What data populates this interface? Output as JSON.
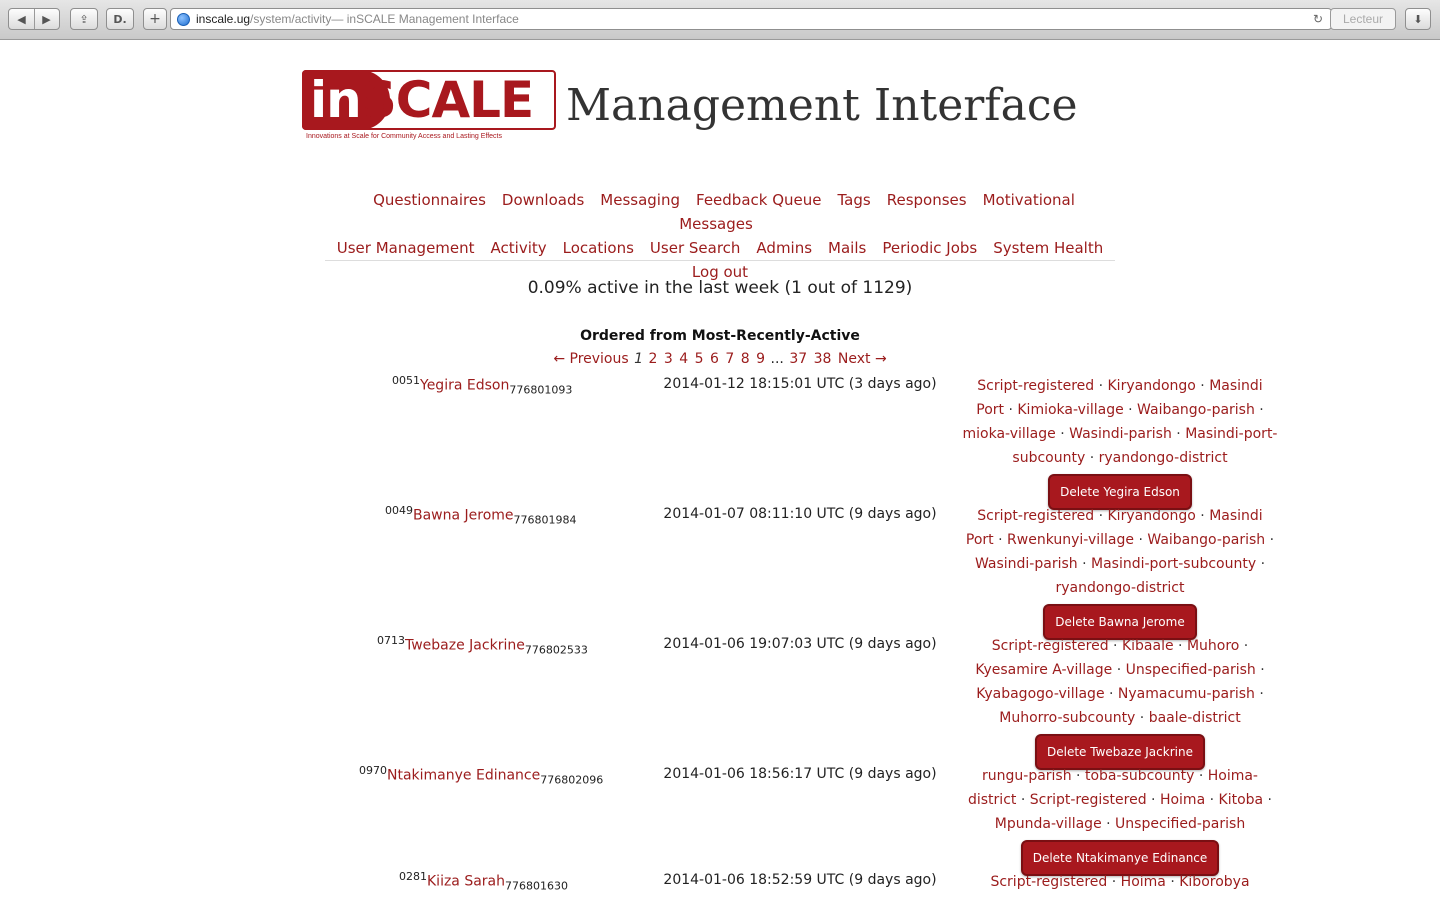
{
  "browser": {
    "url_host": "inscale.ug",
    "url_path": "/system/activity",
    "window_title": " — inSCALE Management Interface",
    "reader_label": "Lecteur"
  },
  "header": {
    "logo_in": "in",
    "logo_scale": "SCALE",
    "logo_tagline": "Innovations at Scale for Community Access and Lasting Effects",
    "title": "Management Interface"
  },
  "nav": {
    "row1": [
      "Questionnaires",
      "Downloads",
      "Messaging",
      "Feedback Queue",
      "Tags",
      "Responses",
      "Motivational Messages"
    ],
    "row2": [
      "User Management",
      "Activity",
      "Locations",
      "User Search",
      "Admins",
      "Mails",
      "Periodic Jobs",
      "System Health"
    ],
    "row3": [
      "Log out"
    ]
  },
  "summary": "0.09% active in the last week (1 out of 1129)",
  "ordered_label": "Ordered from Most-Recently-Active",
  "pager": {
    "previous": "← Previous",
    "current": "1",
    "pages": [
      "2",
      "3",
      "4",
      "5",
      "6",
      "7",
      "8",
      "9"
    ],
    "ellipsis": "...",
    "last_pages": [
      "37",
      "38"
    ],
    "next": "Next →"
  },
  "users": [
    {
      "id": "0051",
      "name": "Yegira Edson",
      "phone": "776801093",
      "date": "2014-01-12 18:15:01 UTC (3 days ago)",
      "tags": [
        "Script-registered",
        "Kiryandongo",
        "Masindi Port",
        "Kimioka-village",
        "Waibango-parish",
        "mioka-village",
        "Wasindi-parish",
        "Masindi-port-subcounty",
        "ryandongo-district"
      ],
      "delete_label": "Delete Yegira Edson"
    },
    {
      "id": "0049",
      "name": "Bawna Jerome",
      "phone": "776801984",
      "date": "2014-01-07 08:11:10 UTC (9 days ago)",
      "tags": [
        "Script-registered",
        "Kiryandongo",
        "Masindi Port",
        "Rwenkunyi-village",
        "Waibango-parish",
        "Wasindi-parish",
        "Masindi-port-subcounty",
        "ryandongo-district"
      ],
      "delete_label": "Delete Bawna Jerome"
    },
    {
      "id": "0713",
      "name": "Twebaze Jackrine",
      "phone": "776802533",
      "date": "2014-01-06 19:07:03 UTC (9 days ago)",
      "tags": [
        "Script-registered",
        "Kibaale",
        "Muhoro",
        "Kyesamire A-village",
        "Unspecified-parish",
        "Kyabagogo-village",
        "Nyamacumu-parish",
        "Muhorro-subcounty",
        "baale-district"
      ],
      "delete_label": "Delete Twebaze Jackrine"
    },
    {
      "id": "0970",
      "name": "Ntakimanye Edinance",
      "phone": "776802096",
      "date": "2014-01-06 18:56:17 UTC (9 days ago)",
      "tags": [
        "rungu-parish",
        "toba-subcounty",
        "Hoima-district",
        "Script-registered",
        "Hoima",
        "Kitoba",
        "Mpunda-village",
        "Unspecified-parish"
      ],
      "delete_label": "Delete Ntakimanye Edinance"
    },
    {
      "id": "0281",
      "name": "Kiiza Sarah",
      "phone": "776801630",
      "date": "2014-01-06 18:52:59 UTC (9 days ago)",
      "tags": [
        "Script-registered",
        "Hoima",
        "Kiborobya"
      ],
      "delete_label": ""
    }
  ]
}
